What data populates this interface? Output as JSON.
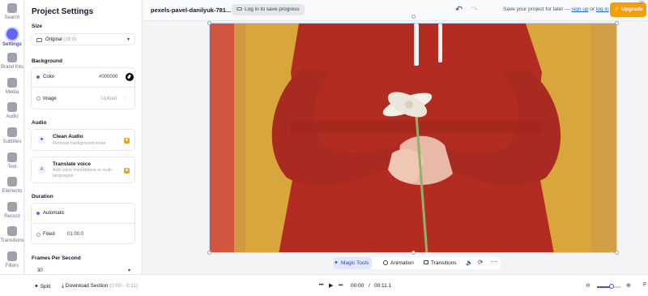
{
  "rail": [
    {
      "label": "Search",
      "icon": "search-icon"
    },
    {
      "label": "Settings",
      "icon": "settings-icon",
      "active": true
    },
    {
      "label": "Brand Kits",
      "icon": "brand-kits-icon"
    },
    {
      "label": "Media",
      "icon": "media-icon"
    },
    {
      "label": "Audio",
      "icon": "audio-icon"
    },
    {
      "label": "Subtitles",
      "icon": "subtitles-icon"
    },
    {
      "label": "Text",
      "icon": "text-icon"
    },
    {
      "label": "Elements",
      "icon": "elements-icon"
    },
    {
      "label": "Record",
      "icon": "record-icon"
    },
    {
      "label": "Transitions",
      "icon": "transitions-icon"
    },
    {
      "label": "Filters",
      "icon": "filters-icon"
    }
  ],
  "panel": {
    "title": "Project Settings",
    "size": {
      "label": "Size",
      "value": "Original",
      "ratio": "(16:9)"
    },
    "background": {
      "label": "Background",
      "color_label": "Color",
      "color_value": "#000000",
      "image_label": "Image",
      "upload_label": "Upload"
    },
    "audio": {
      "label": "Audio",
      "clean_title": "Clean Audio",
      "clean_desc": "Remove background noise",
      "translate_title": "Translate voice",
      "translate_desc": "Add voice translations in multi-languages"
    },
    "duration": {
      "label": "Duration",
      "automatic": "Automatic",
      "fixed": "Fixed",
      "fixed_value": "01:00.0"
    },
    "fps": {
      "label": "Frames Per Second",
      "value": "30"
    }
  },
  "header": {
    "project_name": "pexels-pavel-danilyuk-781...",
    "login_button": "Log in to save progress",
    "save_text": "Save your project for later —",
    "sign_up": "sign up",
    "or": "or",
    "log_in": "log in",
    "upgrade": "Upgrade"
  },
  "toolbar": {
    "magic_tools": "Magic Tools",
    "animation": "Animation",
    "transitions": "Transitions"
  },
  "bottombar": {
    "split": "Split",
    "download": "Download Section",
    "download_range": "(0:00 - 0:11)",
    "current_time": "00:00",
    "separator": "/",
    "total_time": "00:11.1",
    "zoom_level": 0.6
  },
  "colors": {
    "accent": "#6366f1",
    "upgrade": "#f59e0b",
    "dress": "#b92f25",
    "backdrop": "#d8a53a",
    "curtain": "#d2553f"
  }
}
